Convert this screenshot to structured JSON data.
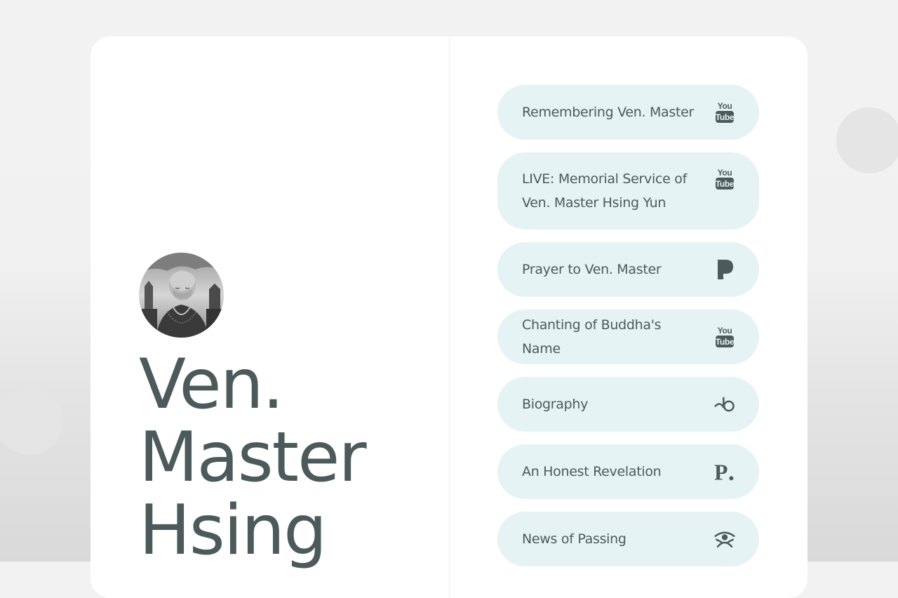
{
  "profile": {
    "title_lines": [
      "Ven.",
      "Master",
      "Hsing"
    ],
    "avatar_icon": "monk-portrait"
  },
  "links": [
    {
      "label": "Remembering Ven. Master",
      "icon": "youtube-icon"
    },
    {
      "label": "LIVE: Memorial Service of Ven. Master Hsing Yun",
      "icon": "youtube-icon"
    },
    {
      "label": "Prayer to Ven. Master",
      "icon": "pandora-icon"
    },
    {
      "label": "Chanting of Buddha's Name",
      "icon": "youtube-icon"
    },
    {
      "label": "Biography",
      "icon": "bandcamp-swirl-icon"
    },
    {
      "label": "An Honest Revelation",
      "icon": "p-dot-icon"
    },
    {
      "label": "News of Passing",
      "icon": "eye-figure-icon"
    }
  ],
  "colors": {
    "page_background": "#f1f1f1",
    "card_background": "#ffffff",
    "button_background": "#e6f3f4",
    "text": "#4c5a5c",
    "decor_circle": "#e5e5e5"
  }
}
